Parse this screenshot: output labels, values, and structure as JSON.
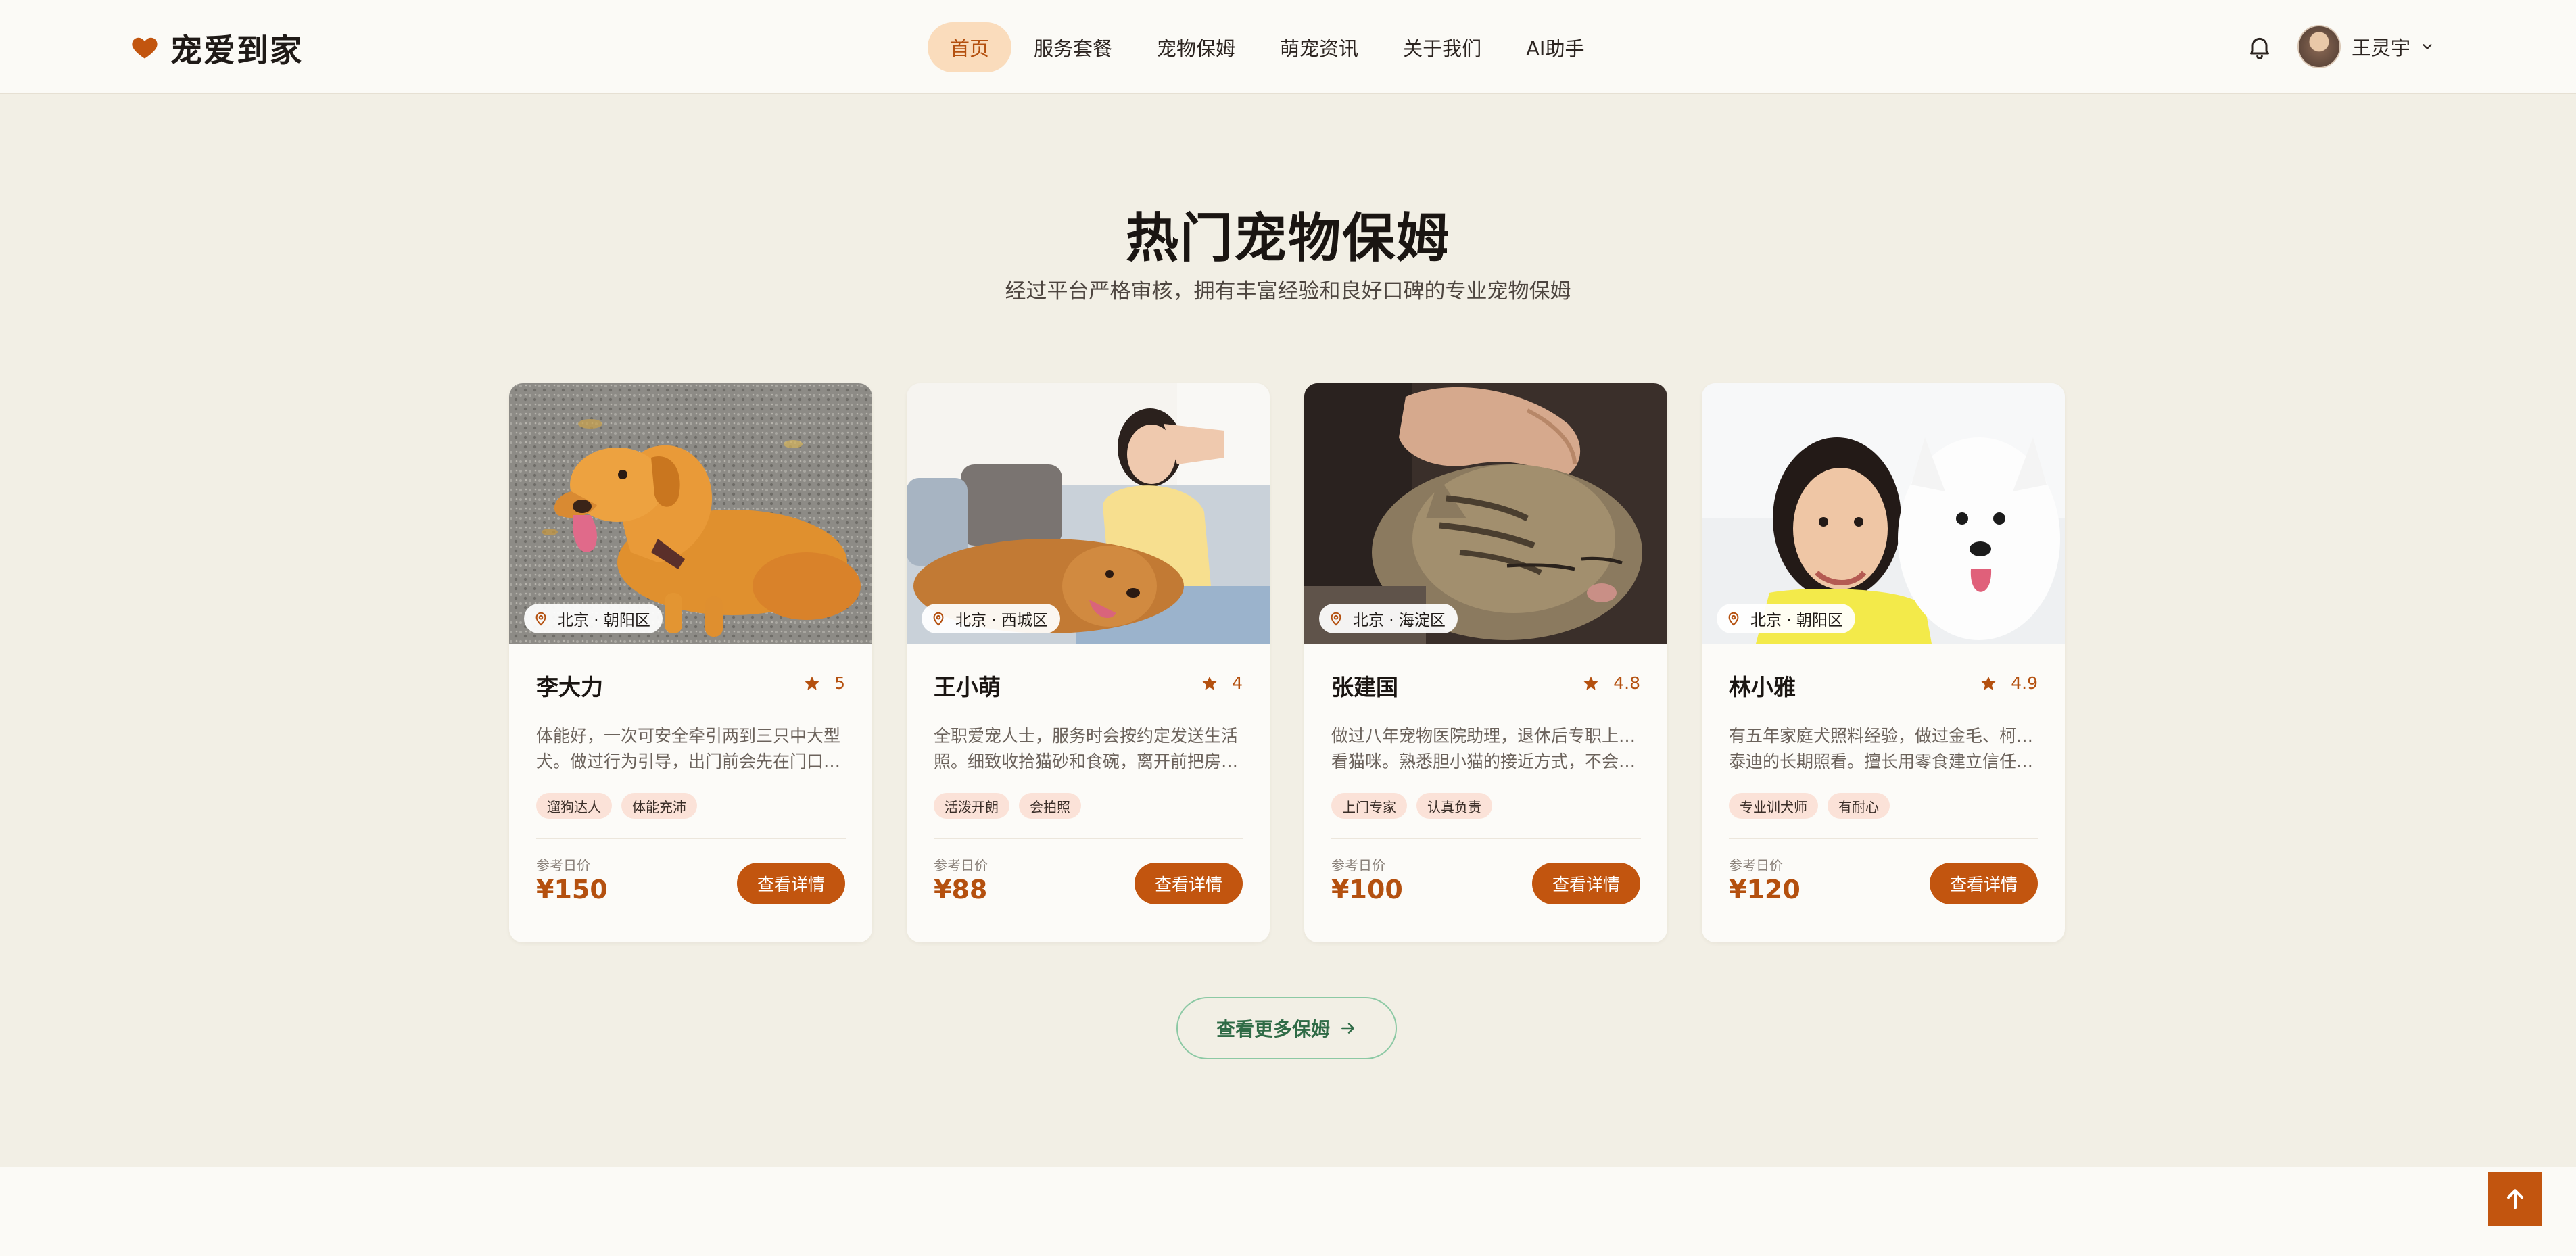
{
  "brand": {
    "name": "宠爱到家",
    "accent": "#c2550f"
  },
  "nav": {
    "items": [
      {
        "label": "首页",
        "active": true
      },
      {
        "label": "服务套餐",
        "active": false
      },
      {
        "label": "宠物保姆",
        "active": false
      },
      {
        "label": "萌宠资讯",
        "active": false
      },
      {
        "label": "关于我们",
        "active": false
      },
      {
        "label": "AI助手",
        "active": false
      }
    ]
  },
  "header": {
    "bell_icon": "bell-icon",
    "user_name": "王灵宇"
  },
  "section": {
    "title": "热门宠物保姆",
    "subtitle": "经过平台严格审核，拥有丰富经验和良好口碑的专业宠物保姆"
  },
  "sitters": [
    {
      "location": "北京 · 朝阳区",
      "name": "李大力",
      "rating": "5",
      "desc_line1": "体能好，一次可安全牵引两到三只中大型",
      "desc_line2": "犬。做过行为引导，出门前会先在门口训…",
      "tags": [
        "遛狗达人",
        "体能充沛"
      ],
      "price_label": "参考日价",
      "price": "¥150",
      "button": "查看详情"
    },
    {
      "location": "北京 · 西城区",
      "name": "王小萌",
      "rating": "4",
      "desc_line1": "全职爱宠人士，服务时会按约定发送生活",
      "desc_line2": "照。细致收拾猫砂和食碗，离开前把房间…",
      "tags": [
        "活泼开朗",
        "会拍照"
      ],
      "price_label": "参考日价",
      "price": "¥88",
      "button": "查看详情"
    },
    {
      "location": "北京 · 海淀区",
      "name": "张建国",
      "rating": "4.8",
      "desc_line1": "做过八年宠物医院助理，退休后专职上门照",
      "desc_line2": "看猫咪。熟悉胆小猫的接近方式，不会强…",
      "tags": [
        "上门专家",
        "认真负责"
      ],
      "price_label": "参考日价",
      "price": "¥100",
      "button": "查看详情"
    },
    {
      "location": "北京 · 朝阳区",
      "name": "林小雅",
      "rating": "4.9",
      "desc_line1": "有五年家庭犬照料经验，做过金毛、柯基和",
      "desc_line2": "泰迪的长期照看。擅长用零食建立信任，…",
      "tags": [
        "专业训犬师",
        "有耐心"
      ],
      "price_label": "参考日价",
      "price": "¥120",
      "button": "查看详情"
    }
  ],
  "more_button": "查看更多保姆"
}
